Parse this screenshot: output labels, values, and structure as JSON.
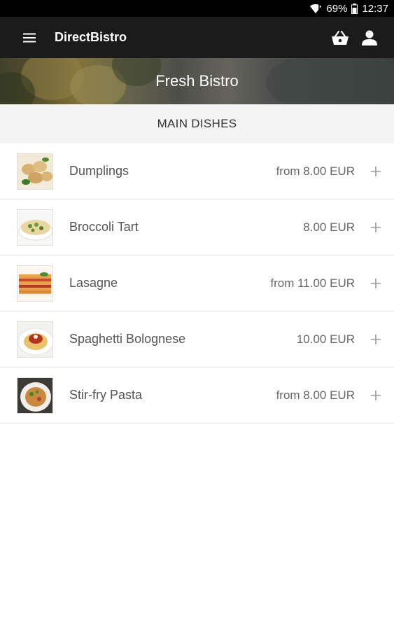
{
  "status_bar": {
    "battery": "69%",
    "time": "12:37",
    "icons": [
      "wifi-icon",
      "battery-icon"
    ]
  },
  "app_bar": {
    "title": "DirectBistro",
    "icons": [
      "menu-icon",
      "basket-icon",
      "account-icon"
    ]
  },
  "banner": {
    "title": "Fresh Bistro"
  },
  "section": {
    "title": "MAIN DISHES"
  },
  "dishes": [
    {
      "name": "Dumplings",
      "price": "from 8.00 EUR",
      "image": "dumplings-image"
    },
    {
      "name": "Broccoli Tart",
      "price": "8.00 EUR",
      "image": "broccoli-tart-image"
    },
    {
      "name": "Lasagne",
      "price": "from 11.00 EUR",
      "image": "lasagne-image"
    },
    {
      "name": "Spaghetti Bolognese",
      "price": "10.00 EUR",
      "image": "spaghetti-bolognese-image"
    },
    {
      "name": "Stir-fry Pasta",
      "price": "from 8.00 EUR",
      "image": "stir-fry-pasta-image"
    }
  ],
  "colors": {
    "status_bar": "#000000",
    "app_bar": "#1b1b1b",
    "section_bg": "#f4f4f4",
    "divider": "#e6e6e6",
    "text": "#555555"
  }
}
